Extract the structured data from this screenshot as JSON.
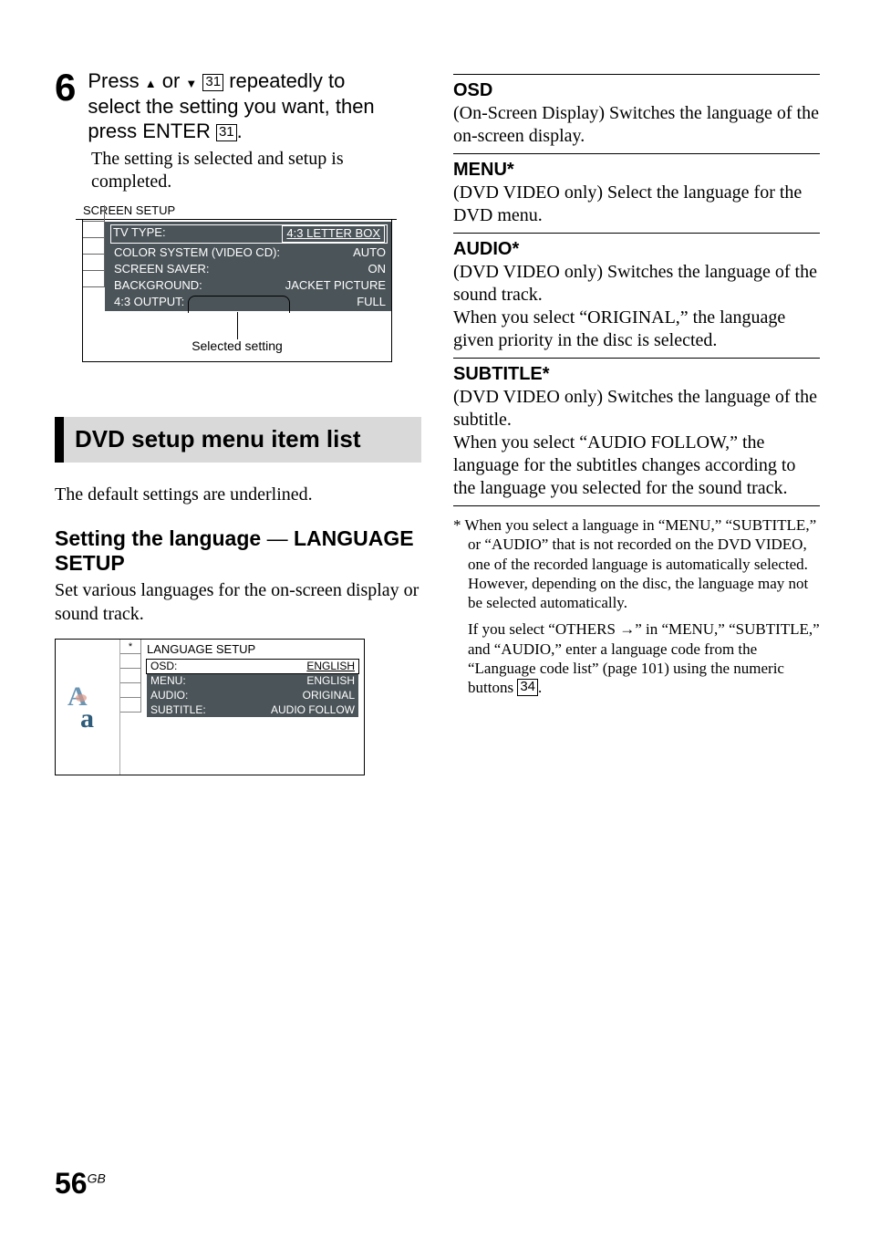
{
  "step": {
    "number": "6",
    "instruction_pre": "Press ",
    "instruction_mid1": " or ",
    "instruction_mid2": " ",
    "ref1": "31",
    "instruction_post1": " repeatedly to select the setting you want, then press ENTER ",
    "ref2": "31",
    "instruction_end": ".",
    "body": "The setting is selected and setup is completed."
  },
  "panel1": {
    "title": "SCREEN SETUP",
    "rows": [
      {
        "label": "TV TYPE:",
        "value": "4:3 LETTER BOX"
      },
      {
        "label": "COLOR SYSTEM (VIDEO CD):",
        "value": "AUTO"
      },
      {
        "label": "SCREEN SAVER:",
        "value": "ON"
      },
      {
        "label": "BACKGROUND:",
        "value": "JACKET PICTURE"
      },
      {
        "label": "4:3 OUTPUT:",
        "value": "FULL"
      }
    ],
    "caption": "Selected setting"
  },
  "banner": "DVD setup menu item list",
  "intro": "The default settings are underlined.",
  "subhead_pre": "Setting the language",
  "subhead_dash": " — ",
  "subhead_post": "LANGUAGE SETUP",
  "subbody": "Set various languages for the on-screen display or sound track.",
  "panel2": {
    "title": "LANGUAGE SETUP",
    "rows": [
      {
        "label": "OSD:",
        "value": "ENGLISH"
      },
      {
        "label": "MENU:",
        "value": "ENGLISH"
      },
      {
        "label": "AUDIO:",
        "value": "ORIGINAL"
      },
      {
        "label": "SUBTITLE:",
        "value": "AUDIO FOLLOW"
      }
    ]
  },
  "right": {
    "osd": {
      "term": "OSD",
      "desc": "(On-Screen Display) Switches the language of the on-screen display."
    },
    "menu": {
      "term": "MENU*",
      "desc": "(DVD VIDEO only) Select the language for the DVD menu."
    },
    "audio": {
      "term": "AUDIO*",
      "desc": "(DVD VIDEO only) Switches the language of the sound track.\nWhen you select “ORIGINAL,” the language given priority in the disc is selected."
    },
    "subtitle": {
      "term": "SUBTITLE*",
      "desc": "(DVD VIDEO only) Switches the language of the subtitle.\nWhen you select “AUDIO FOLLOW,” the language for the subtitles changes according to the language you selected for the sound track."
    },
    "foot1": "* When you select a language in “MENU,” “SUBTITLE,” or “AUDIO” that is not recorded on the DVD VIDEO, one of the recorded language is automatically selected. However, depending on the disc, the language may not be selected automatically.",
    "foot2_pre": "If you select “OTHERS ",
    "foot2_post": "” in “MENU,” “SUBTITLE,” and “AUDIO,” enter a language code from the “Language code list” (page 101) using the numeric buttons ",
    "foot2_ref": "34",
    "foot2_end": "."
  },
  "page": "56",
  "page_suffix": "GB"
}
